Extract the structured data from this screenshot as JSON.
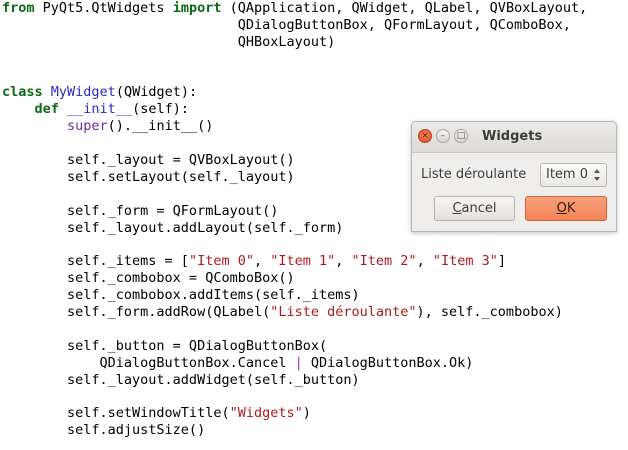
{
  "code": {
    "lines": [
      [
        {
          "t": "from",
          "c": "kw"
        },
        {
          "t": " PyQt5.QtWidgets ",
          "c": ""
        },
        {
          "t": "import",
          "c": "kw"
        },
        {
          "t": " (QApplication, QWidget, QLabel, QVBoxLayout,",
          "c": ""
        }
      ],
      [
        {
          "t": "                             QDialogButtonBox, QFormLayout, QComboBox,",
          "c": ""
        }
      ],
      [
        {
          "t": "                             QHBoxLayout)",
          "c": ""
        }
      ],
      [],
      [],
      [
        {
          "t": "class",
          "c": "kw"
        },
        {
          "t": " ",
          "c": ""
        },
        {
          "t": "MyWidget",
          "c": "cls"
        },
        {
          "t": "(QWidget):",
          "c": ""
        }
      ],
      [
        {
          "t": "    ",
          "c": ""
        },
        {
          "t": "def",
          "c": "kw"
        },
        {
          "t": " ",
          "c": ""
        },
        {
          "t": "__init__",
          "c": "fn"
        },
        {
          "t": "(self):",
          "c": ""
        }
      ],
      [
        {
          "t": "        ",
          "c": ""
        },
        {
          "t": "super",
          "c": "builtin"
        },
        {
          "t": "().__init__()",
          "c": ""
        }
      ],
      [],
      [
        {
          "t": "        self._layout = QVBoxLayout()",
          "c": ""
        }
      ],
      [
        {
          "t": "        self.setLayout(self._layout)",
          "c": ""
        }
      ],
      [],
      [
        {
          "t": "        self._form = QFormLayout()",
          "c": ""
        }
      ],
      [
        {
          "t": "        self._layout.addLayout(self._form)",
          "c": ""
        }
      ],
      [],
      [
        {
          "t": "        self._items = [",
          "c": ""
        },
        {
          "t": "\"Item 0\"",
          "c": "str"
        },
        {
          "t": ", ",
          "c": ""
        },
        {
          "t": "\"Item 1\"",
          "c": "str"
        },
        {
          "t": ", ",
          "c": ""
        },
        {
          "t": "\"Item 2\"",
          "c": "str"
        },
        {
          "t": ", ",
          "c": ""
        },
        {
          "t": "\"Item 3\"",
          "c": "str"
        },
        {
          "t": "]",
          "c": ""
        }
      ],
      [
        {
          "t": "        self._combobox = QComboBox()",
          "c": ""
        }
      ],
      [
        {
          "t": "        self._combobox.addItems(self._items)",
          "c": ""
        }
      ],
      [
        {
          "t": "        self._form.addRow(QLabel(",
          "c": ""
        },
        {
          "t": "\"Liste déroulante\"",
          "c": "str"
        },
        {
          "t": "), self._combobox)",
          "c": ""
        }
      ],
      [],
      [
        {
          "t": "        self._button = QDialogButtonBox(",
          "c": ""
        }
      ],
      [
        {
          "t": "            QDialogButtonBox.Cancel ",
          "c": ""
        },
        {
          "t": "|",
          "c": "op"
        },
        {
          "t": " QDialogButtonBox.Ok)",
          "c": ""
        }
      ],
      [
        {
          "t": "        self._layout.addWidget(self._button)",
          "c": ""
        }
      ],
      [],
      [
        {
          "t": "        self.setWindowTitle(",
          "c": ""
        },
        {
          "t": "\"Widgets\"",
          "c": "str"
        },
        {
          "t": ")",
          "c": ""
        }
      ],
      [
        {
          "t": "        self.adjustSize()",
          "c": ""
        }
      ]
    ]
  },
  "window": {
    "title": "Widgets",
    "title_buttons": {
      "close_glyph": "×",
      "minimize_glyph": "–",
      "maximize_glyph": "□"
    },
    "form": {
      "label": "Liste déroulante",
      "combo_value": "Item 0"
    },
    "buttons": {
      "cancel_mnemonic": "C",
      "cancel_rest": "ancel",
      "ok_mnemonic": "O",
      "ok_rest": "K"
    }
  },
  "colors": {
    "keyword": "#0b6a14",
    "function_name": "#2a2ac2",
    "builtin": "#6f2a9e",
    "string": "#b0191b",
    "ok_button": "#f38457",
    "close_button": "#e0491e"
  },
  "icons": {
    "close": "close-icon",
    "minimize": "minimize-icon",
    "maximize": "maximize-icon",
    "combo_arrows": "chevron-up-down-icon"
  }
}
